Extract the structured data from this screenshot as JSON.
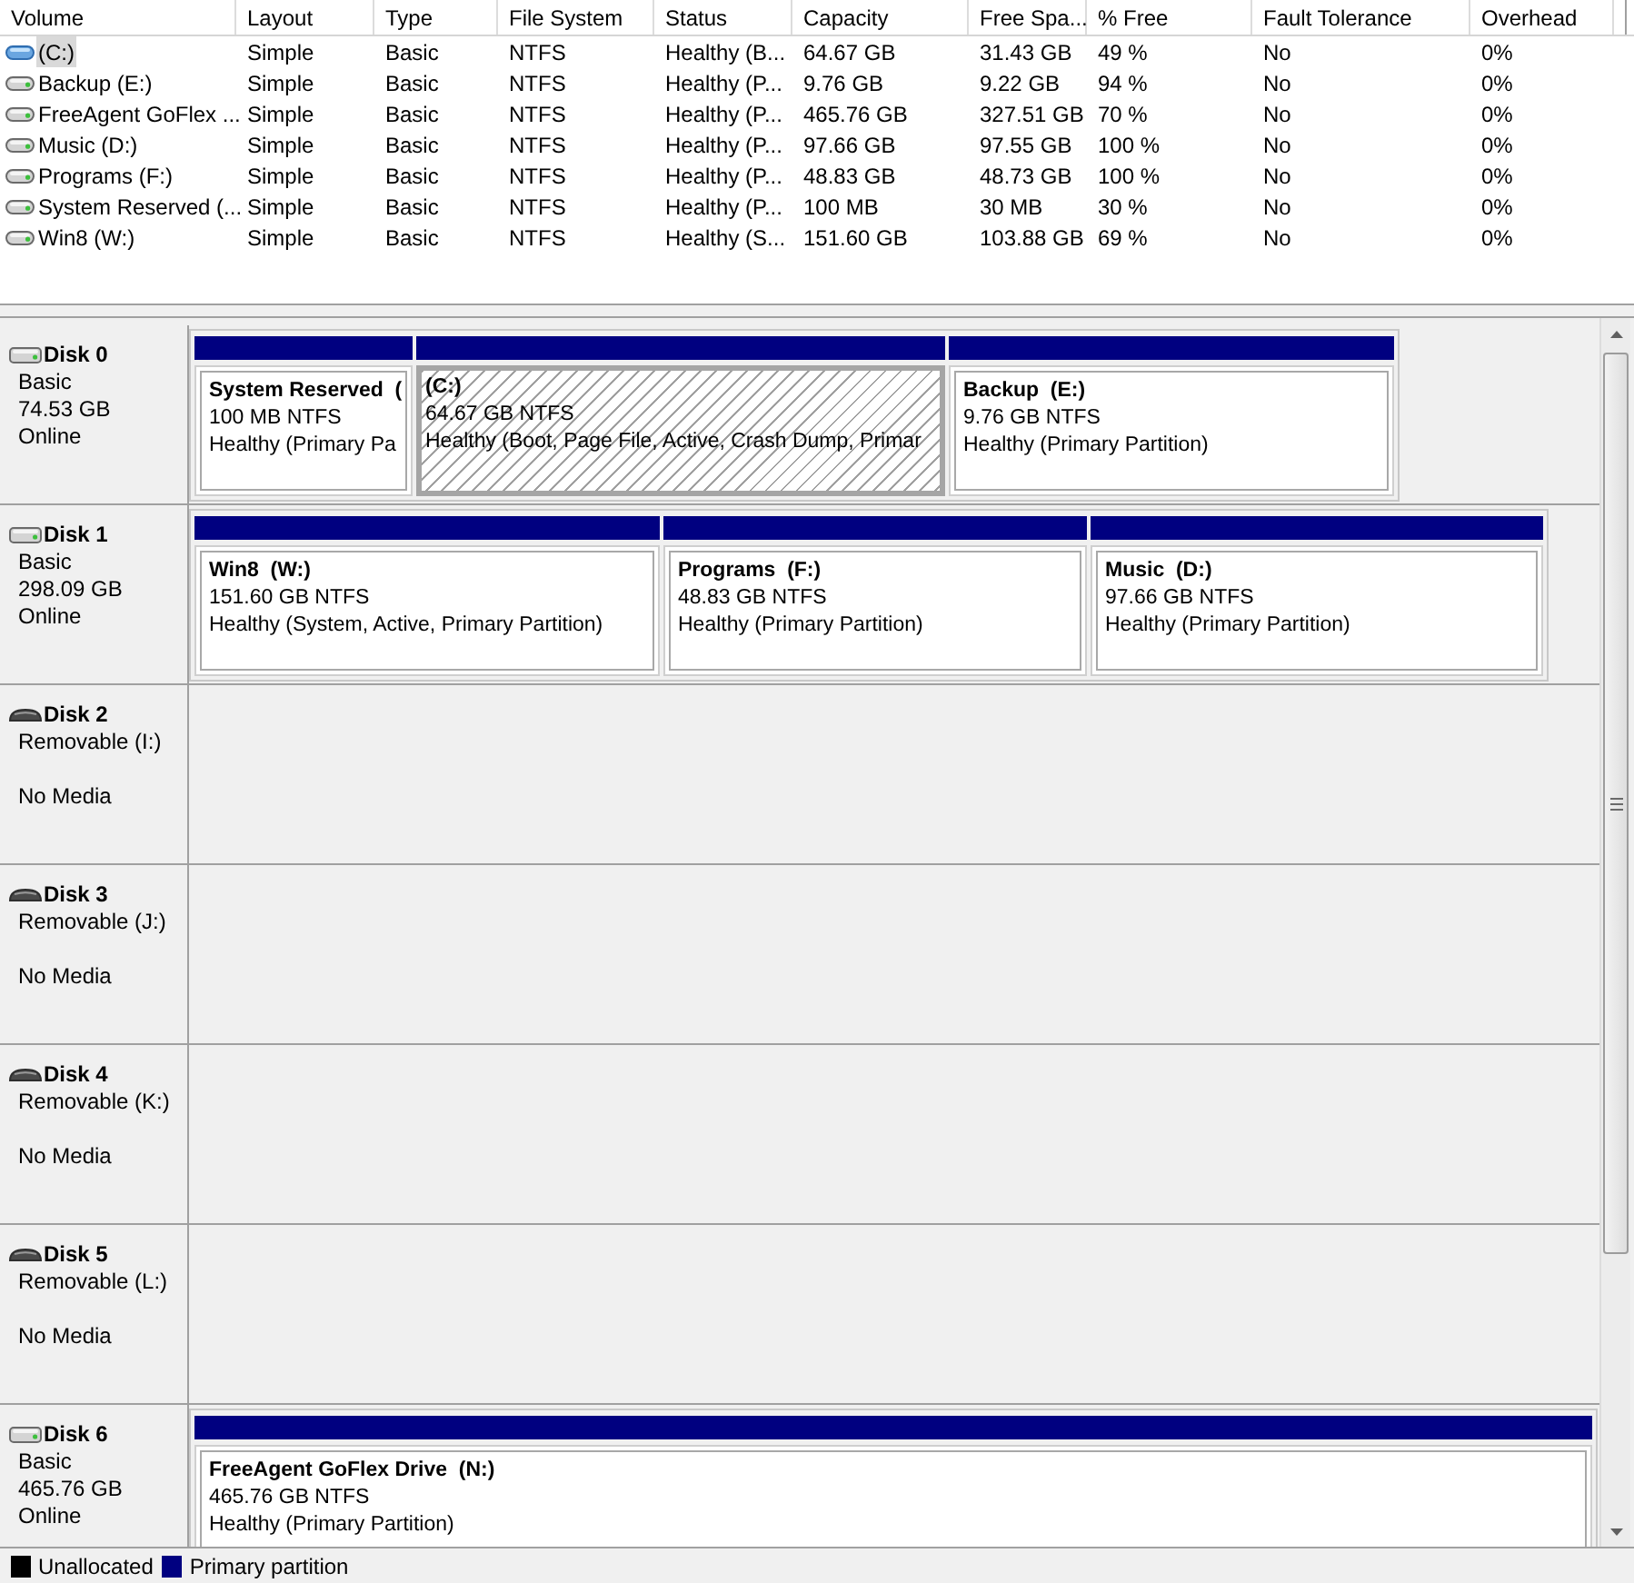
{
  "volume_table": {
    "columns": [
      "Volume",
      "Layout",
      "Type",
      "File System",
      "Status",
      "Capacity",
      "Free Spa...",
      "% Free",
      "Fault Tolerance",
      "Overhead"
    ],
    "rows": [
      {
        "kind": "boot",
        "selected": true,
        "cells": [
          "(C:)",
          "Simple",
          "Basic",
          "NTFS",
          "Healthy (B...",
          "64.67 GB",
          "31.43 GB",
          "49 %",
          "No",
          "0%"
        ]
      },
      {
        "kind": "simple",
        "selected": false,
        "cells": [
          "Backup (E:)",
          "Simple",
          "Basic",
          "NTFS",
          "Healthy (P...",
          "9.76 GB",
          "9.22 GB",
          "94 %",
          "No",
          "0%"
        ]
      },
      {
        "kind": "simple",
        "selected": false,
        "cells": [
          "FreeAgent GoFlex ...",
          "Simple",
          "Basic",
          "NTFS",
          "Healthy (P...",
          "465.76 GB",
          "327.51 GB",
          "70 %",
          "No",
          "0%"
        ]
      },
      {
        "kind": "simple",
        "selected": false,
        "cells": [
          "Music (D:)",
          "Simple",
          "Basic",
          "NTFS",
          "Healthy (P...",
          "97.66 GB",
          "97.55 GB",
          "100 %",
          "No",
          "0%"
        ]
      },
      {
        "kind": "simple",
        "selected": false,
        "cells": [
          "Programs (F:)",
          "Simple",
          "Basic",
          "NTFS",
          "Healthy (P...",
          "48.83 GB",
          "48.73 GB",
          "100 %",
          "No",
          "0%"
        ]
      },
      {
        "kind": "simple",
        "selected": false,
        "cells": [
          "System Reserved (...",
          "Simple",
          "Basic",
          "NTFS",
          "Healthy (P...",
          "100 MB",
          "30 MB",
          "30 %",
          "No",
          "0%"
        ]
      },
      {
        "kind": "simple",
        "selected": false,
        "cells": [
          "Win8 (W:)",
          "Simple",
          "Basic",
          "NTFS",
          "Healthy (S...",
          "151.60 GB",
          "103.88 GB",
          "69 %",
          "No",
          "0%"
        ]
      }
    ]
  },
  "disks": [
    {
      "name": "Disk 0",
      "kind": "basic",
      "type": "Basic",
      "size": "74.53 GB",
      "status": "Online",
      "partitions": [
        {
          "kind": "primary",
          "selected": false,
          "label": "System Reserved  (",
          "size": "100 MB NTFS",
          "status": "Healthy (Primary Pa"
        },
        {
          "kind": "primary",
          "selected": true,
          "label": "(C:)",
          "size": "64.67 GB NTFS",
          "status": "Healthy (Boot, Page File, Active, Crash Dump, Primar"
        },
        {
          "kind": "primary",
          "selected": false,
          "label": "Backup  (E:)",
          "size": "9.76 GB NTFS",
          "status": "Healthy (Primary Partition)"
        }
      ]
    },
    {
      "name": "Disk 1",
      "kind": "basic",
      "type": "Basic",
      "size": "298.09 GB",
      "status": "Online",
      "partitions": [
        {
          "kind": "primary",
          "selected": false,
          "label": "Win8  (W:)",
          "size": "151.60 GB NTFS",
          "status": "Healthy (System, Active, Primary Partition)"
        },
        {
          "kind": "primary",
          "selected": false,
          "label": "Programs  (F:)",
          "size": "48.83 GB NTFS",
          "status": "Healthy (Primary Partition)"
        },
        {
          "kind": "primary",
          "selected": false,
          "label": "Music  (D:)",
          "size": "97.66 GB NTFS",
          "status": "Healthy (Primary Partition)"
        }
      ]
    },
    {
      "name": "Disk 2",
      "kind": "removable",
      "type": "Removable (I:)",
      "status": "No Media"
    },
    {
      "name": "Disk 3",
      "kind": "removable",
      "type": "Removable (J:)",
      "status": "No Media"
    },
    {
      "name": "Disk 4",
      "kind": "removable",
      "type": "Removable (K:)",
      "status": "No Media"
    },
    {
      "name": "Disk 5",
      "kind": "removable",
      "type": "Removable (L:)",
      "status": "No Media"
    },
    {
      "name": "Disk 6",
      "kind": "basic",
      "type": "Basic",
      "size": "465.76 GB",
      "status": "Online",
      "partitions": [
        {
          "kind": "primary",
          "selected": false,
          "label": "FreeAgent GoFlex Drive  (N:)",
          "size": "465.76 GB NTFS",
          "status": "Healthy (Primary Partition)"
        }
      ]
    }
  ],
  "legend": [
    {
      "label": "Unallocated",
      "color": "#000000"
    },
    {
      "label": "Primary partition",
      "color": "#000080"
    }
  ]
}
